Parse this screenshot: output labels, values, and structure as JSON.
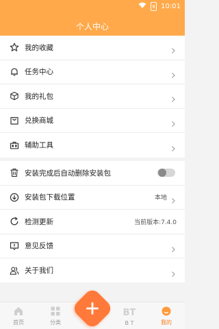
{
  "status": {
    "time": "10:01",
    "battery": "8"
  },
  "header": {
    "title": "个人中心"
  },
  "group1": [
    {
      "label": "我的收藏",
      "icon": "star-icon"
    },
    {
      "label": "任务中心",
      "icon": "bell-icon"
    },
    {
      "label": "我的礼包",
      "icon": "cube-icon"
    },
    {
      "label": "兑换商城",
      "icon": "shopping-bag-icon"
    },
    {
      "label": "辅助工具",
      "icon": "toolbox-icon"
    }
  ],
  "group2": [
    {
      "label": "安装完成后自动删除安装包",
      "icon": "trash-icon",
      "toggle": false
    },
    {
      "label": "安装包下载位置",
      "icon": "download-circle-icon",
      "value": "本地"
    },
    {
      "label": "检测更新",
      "icon": "refresh-icon",
      "value": "当前版本:7.4.0"
    },
    {
      "label": "意见反馈",
      "icon": "feedback-icon"
    },
    {
      "label": "关于我们",
      "icon": "users-icon"
    }
  ],
  "tabbar": {
    "items": [
      {
        "label": "首页",
        "icon": "home-icon"
      },
      {
        "label": "分类",
        "icon": "grid-icon"
      },
      {
        "label": "",
        "icon": "plus-icon"
      },
      {
        "label": "B T",
        "icon": "bt-icon"
      },
      {
        "label": "我的",
        "icon": "profile-icon"
      }
    ],
    "active": "我的"
  },
  "colors": {
    "accent": "#ffa94a",
    "active_tab": "#f57f1f",
    "fab": "#ff7a3a"
  }
}
